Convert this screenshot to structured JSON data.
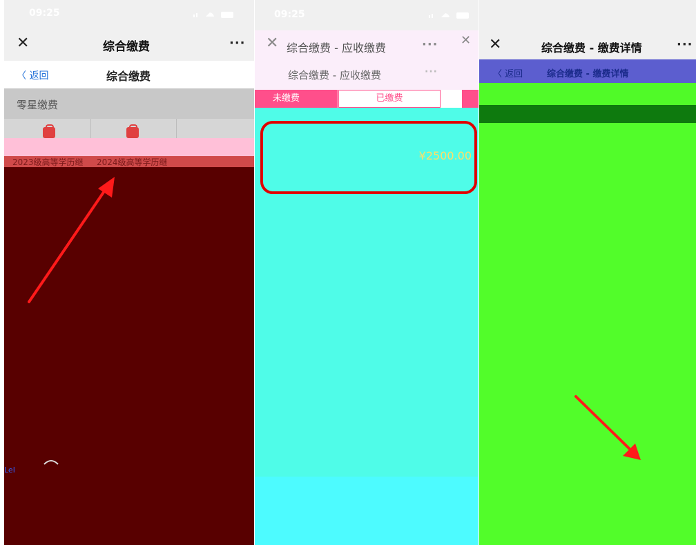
{
  "panel1": {
    "status_time": "09:25",
    "nav_title": "综合缴费",
    "more": "···",
    "close": "✕",
    "back": "〈 返回",
    "sub_title": "综合缴费",
    "section_title": "零星缴费",
    "items": [
      {
        "label": "2023级高等学历继"
      },
      {
        "label": "2024级高等学历继"
      }
    ],
    "corner_text": "Lel"
  },
  "panel2": {
    "status_time": "09:25",
    "nav_title": "综合缴费 - 应收缴费",
    "more": "···",
    "close": "✕",
    "sub_title": "综合缴费 - 应收缴费",
    "sub_more": "···",
    "tab_unpaid": "未缴费",
    "tab_paid": "已缴费",
    "amount": "¥2500.00"
  },
  "panel3": {
    "nav_title": "综合缴费 - 缴费详情",
    "more": "···",
    "close": "✕",
    "back": "〈 返回",
    "sub_title": "综合缴费 - 缴费详情"
  },
  "colors": {
    "arrow": "#ff1a1a",
    "highlight": "#e00000",
    "panel2_accent": "#ff4f8b"
  }
}
